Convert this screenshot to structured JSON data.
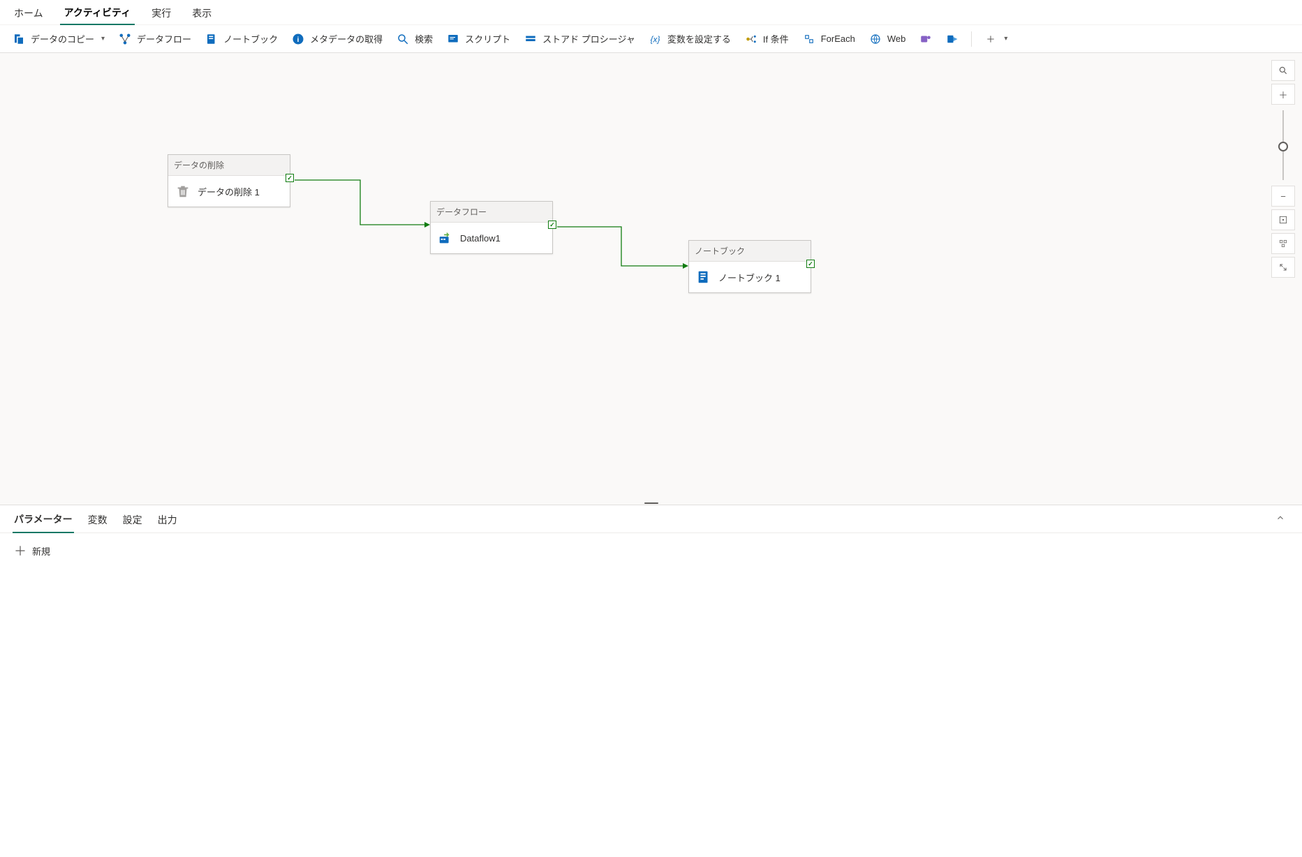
{
  "topTabs": {
    "home": "ホーム",
    "activity": "アクティビティ",
    "run": "実行",
    "display": "表示"
  },
  "toolbar": {
    "copyData": "データのコピー",
    "dataflow": "データフロー",
    "notebook": "ノートブック",
    "getMetadata": "メタデータの取得",
    "search": "検索",
    "script": "スクリプト",
    "storedProc": "ストアド プロシージャ",
    "setVariable": "変数を設定する",
    "ifCondition": "If 条件",
    "forEach": "ForEach",
    "web": "Web"
  },
  "nodes": {
    "delete": {
      "header": "データの削除",
      "label": "データの削除 1"
    },
    "dataflow": {
      "header": "データフロー",
      "label": "Dataflow1"
    },
    "notebook": {
      "header": "ノートブック",
      "label": "ノートブック 1"
    }
  },
  "bottomTabs": {
    "parameters": "パラメーター",
    "variables": "変数",
    "settings": "設定",
    "output": "出力"
  },
  "panel": {
    "new": "新規"
  }
}
